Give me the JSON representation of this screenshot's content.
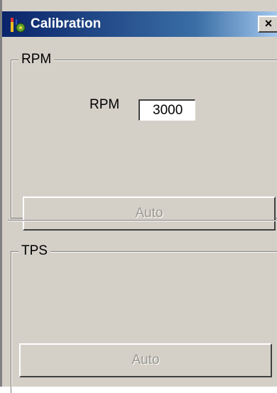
{
  "window": {
    "title": "Calibration",
    "icon": "calibration-app-icon",
    "close_label": "×"
  },
  "rpm_group": {
    "label": "RPM",
    "field_label": "RPM",
    "field_value": "3000",
    "auto_label": "Auto",
    "auto_enabled": false
  },
  "tps_group": {
    "label": "TPS",
    "auto_label": "Auto",
    "auto_enabled": false
  },
  "colors": {
    "titlebar_start": "#0a246a",
    "titlebar_end": "#a6caf0",
    "face": "#d4d0c8",
    "disabled_text": "#9a9890"
  }
}
